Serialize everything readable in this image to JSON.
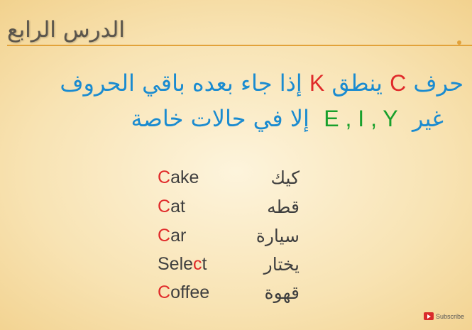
{
  "slide": {
    "title": "الدرس الرابع",
    "line1": {
      "part1": "حرف",
      "letter_c": "C",
      "part2": "ينطق",
      "letter_k": "K",
      "part3": "إذا جاء بعده باقي الحروف"
    },
    "line2": {
      "part1": "غير",
      "letters": "E , I , Y",
      "part2": "إلا في حالات خاصة"
    },
    "examples": [
      {
        "word_hl": "C",
        "word_rest": "ake",
        "arabic": "كيك"
      },
      {
        "word_hl": "C",
        "word_rest": "at",
        "arabic": "قطه"
      },
      {
        "word_hl": "C",
        "word_rest": "ar",
        "arabic": "سيارة"
      },
      {
        "word_pre": "Sele",
        "word_hl": "c",
        "word_rest": "t",
        "arabic": "يختار"
      },
      {
        "word_hl": "C",
        "word_rest": "offee",
        "arabic": "قهوة"
      }
    ]
  },
  "subscribe": {
    "label": "Subscribe",
    "icon": "youtube-icon"
  },
  "colors": {
    "accent_blue": "#1a8bd0",
    "accent_red": "#e02a2a",
    "accent_green": "#18a02c",
    "rule": "#e2a23a"
  }
}
